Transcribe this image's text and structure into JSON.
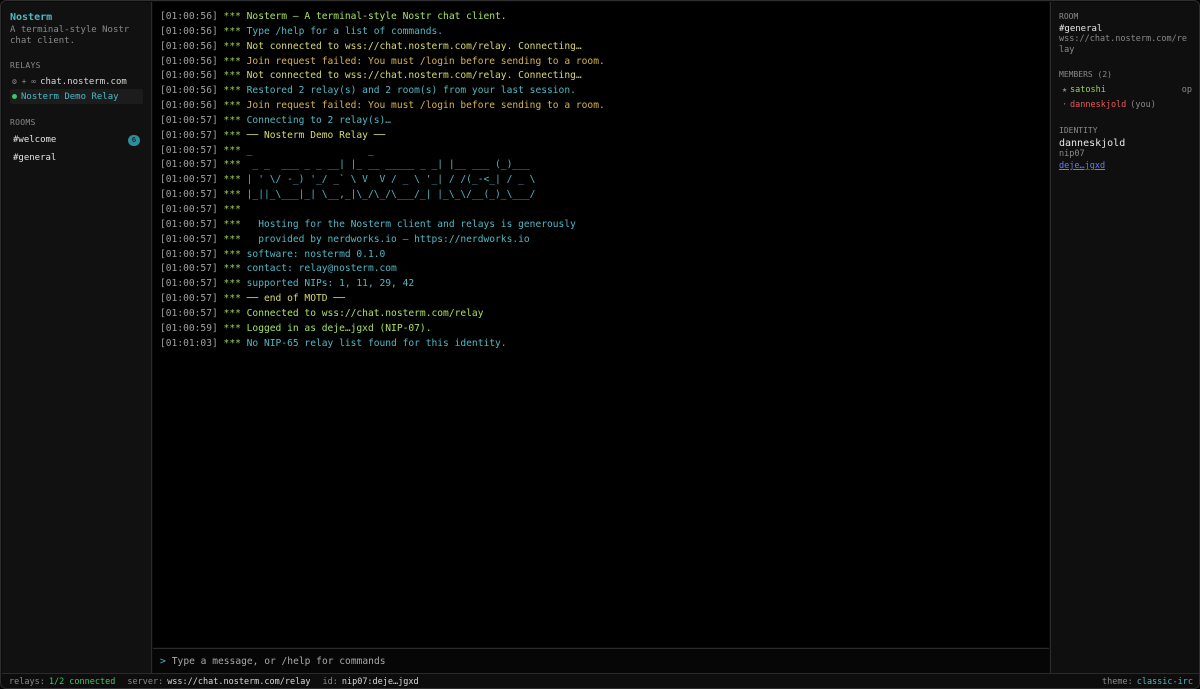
{
  "sidebar": {
    "title": "Nosterm",
    "subtitle": "A terminal-style Nostr chat client.",
    "relays_label": "RELAYS",
    "relays": [
      {
        "icons": "⚙ + ∞",
        "name": "chat.nosterm.com"
      },
      {
        "name": "Nosterm Demo Relay"
      }
    ],
    "rooms_label": "ROOMS",
    "rooms": [
      {
        "name": "#welcome",
        "badge": "6"
      },
      {
        "name": "#general"
      }
    ]
  },
  "log": [
    {
      "ts": "[01:00:56]",
      "stars": "***",
      "text": "Nosterm — A terminal-style Nostr chat client.",
      "kind": "good"
    },
    {
      "ts": "[01:00:56]",
      "stars": "***",
      "text": "Type /help for a list of commands.",
      "kind": "info"
    },
    {
      "ts": "[01:00:56]",
      "stars": "***",
      "text": "Not connected to wss://chat.nosterm.com/relay. Connecting…",
      "kind": "system"
    },
    {
      "ts": "[01:00:56]",
      "stars": "***",
      "text": "Join request failed: You must /login before sending to a room.",
      "kind": "warn"
    },
    {
      "ts": "[01:00:56]",
      "stars": "***",
      "text": "Not connected to wss://chat.nosterm.com/relay. Connecting…",
      "kind": "system"
    },
    {
      "ts": "[01:00:56]",
      "stars": "***",
      "text": "Restored 2 relay(s) and 2 room(s) from your last session.",
      "kind": "info"
    },
    {
      "ts": "[01:00:56]",
      "stars": "***",
      "text": "Join request failed: You must /login before sending to a room.",
      "kind": "warn"
    },
    {
      "ts": "[01:00:57]",
      "stars": "***",
      "text": "Connecting to 2 relay(s)…",
      "kind": "info"
    },
    {
      "ts": "[01:00:57]",
      "stars": "***",
      "text": "── Nosterm Demo Relay ──",
      "kind": "system"
    },
    {
      "ts": "[01:00:57]",
      "stars": "***",
      "text": "_                    _",
      "kind": "info"
    },
    {
      "ts": "[01:00:57]",
      "stars": "***",
      "text": " _ _  ___ _ _ __| |_ __ _____ _ _| |__ ___ (_)___",
      "kind": "info"
    },
    {
      "ts": "[01:00:57]",
      "stars": "***",
      "text": "| ' \\/ -_) '_/ _` \\ V  V / _ \\ '_| / /(_-<_| / _ \\",
      "kind": "info"
    },
    {
      "ts": "[01:00:57]",
      "stars": "***",
      "text": "|_||_\\___|_| \\__,_|\\_/\\_/\\___/_| |_\\_\\/__(_)_\\___/",
      "kind": "info"
    },
    {
      "ts": "[01:00:57]",
      "stars": "***",
      "text": "",
      "kind": "info"
    },
    {
      "ts": "[01:00:57]",
      "stars": "***",
      "text": "  Hosting for the Nosterm client and relays is generously",
      "kind": "info"
    },
    {
      "ts": "[01:00:57]",
      "stars": "***",
      "text": "  provided by nerdworks.io — https://nerdworks.io",
      "kind": "info"
    },
    {
      "ts": "[01:00:57]",
      "stars": "***",
      "text": "software: nostermd 0.1.0",
      "kind": "info"
    },
    {
      "ts": "[01:00:57]",
      "stars": "***",
      "text": "contact: relay@nosterm.com",
      "kind": "info"
    },
    {
      "ts": "[01:00:57]",
      "stars": "***",
      "text": "supported NIPs: 1, 11, 29, 42",
      "kind": "info"
    },
    {
      "ts": "[01:00:57]",
      "stars": "***",
      "text": "── end of MOTD ──",
      "kind": "system"
    },
    {
      "ts": "[01:00:57]",
      "stars": "***",
      "text": "Connected to wss://chat.nosterm.com/relay",
      "kind": "good"
    },
    {
      "ts": "[01:00:59]",
      "stars": "***",
      "text": "Logged in as deje…jgxd (NIP-07).",
      "kind": "good"
    },
    {
      "ts": "[01:01:03]",
      "stars": "***",
      "text": "No NIP-65 relay list found for this identity.",
      "kind": "info"
    }
  ],
  "input": {
    "caret": ">",
    "placeholder": "Type a message, or /help for commands"
  },
  "right": {
    "room_label": "ROOM",
    "room_name": "#general",
    "room_url": "wss://chat.nosterm.com/relay",
    "members_label": "MEMBERS (2)",
    "members": [
      {
        "mark": "★",
        "name": "satoshi",
        "right": "op",
        "role": "op"
      },
      {
        "mark": "·",
        "name": "danneskjold",
        "tag": "(you)",
        "role": "you"
      }
    ],
    "identity_label": "IDENTITY",
    "identity_name": "danneskjold",
    "identity_method": "nip07",
    "identity_pubkey": "deje…jgxd"
  },
  "status": {
    "relays_label": "relays:",
    "relays_value": "1/2 connected",
    "server_label": "server:",
    "server_value": "wss://chat.nosterm.com/relay",
    "id_label": "id:",
    "id_value": "nip07:deje…jgxd",
    "theme_label": "theme:",
    "theme_value": "classic-irc"
  }
}
